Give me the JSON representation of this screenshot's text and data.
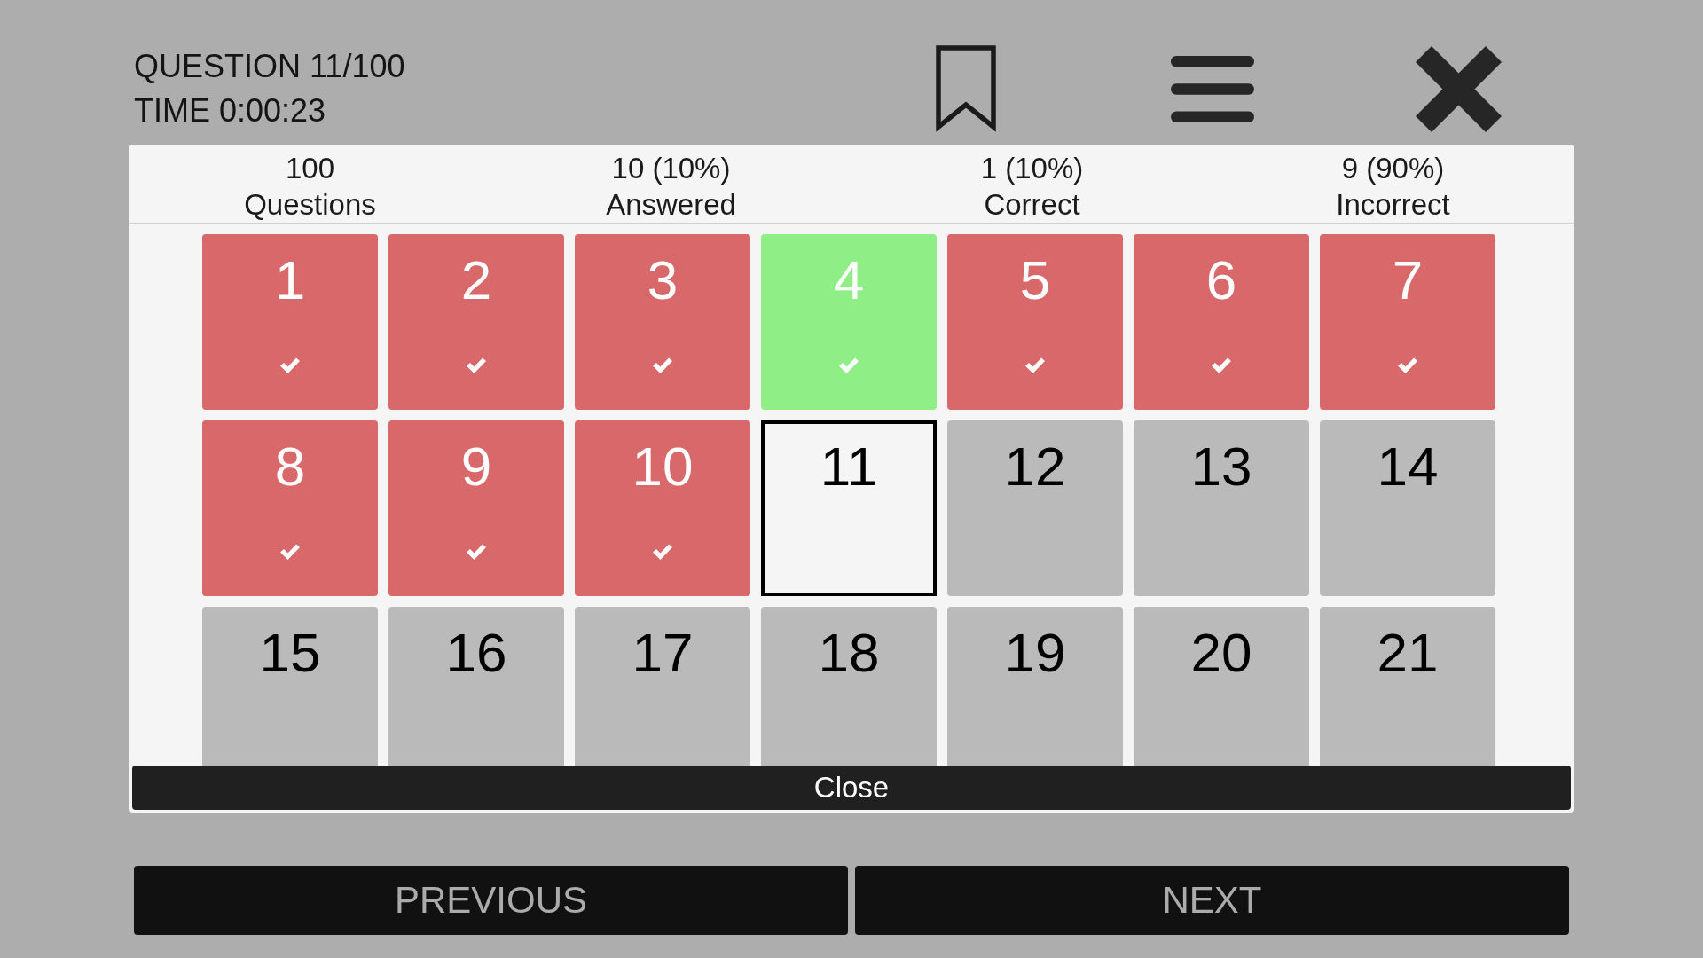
{
  "header": {
    "question": "QUESTION 11/100",
    "time": "TIME 0:00:23"
  },
  "stats": [
    {
      "value": "100",
      "label": "Questions"
    },
    {
      "value": "10 (10%)",
      "label": "Answered"
    },
    {
      "value": "1 (10%)",
      "label": "Correct"
    },
    {
      "value": "9 (90%)",
      "label": "Incorrect"
    }
  ],
  "questions": [
    {
      "number": "1",
      "answered": true,
      "correct": false,
      "selected": false
    },
    {
      "number": "2",
      "answered": true,
      "correct": false,
      "selected": false
    },
    {
      "number": "3",
      "answered": true,
      "correct": false,
      "selected": false
    },
    {
      "number": "4",
      "answered": true,
      "correct": true,
      "selected": false
    },
    {
      "number": "5",
      "answered": true,
      "correct": false,
      "selected": false
    },
    {
      "number": "6",
      "answered": true,
      "correct": false,
      "selected": false
    },
    {
      "number": "7",
      "answered": true,
      "correct": false,
      "selected": false
    },
    {
      "number": "8",
      "answered": true,
      "correct": false,
      "selected": false
    },
    {
      "number": "9",
      "answered": true,
      "correct": false,
      "selected": false
    },
    {
      "number": "10",
      "answered": true,
      "correct": false,
      "selected": false
    },
    {
      "number": "11",
      "answered": false,
      "correct": false,
      "selected": true
    },
    {
      "number": "12",
      "answered": false,
      "correct": false,
      "selected": false
    },
    {
      "number": "13",
      "answered": false,
      "correct": false,
      "selected": false
    },
    {
      "number": "14",
      "answered": false,
      "correct": false,
      "selected": false
    },
    {
      "number": "15",
      "answered": false,
      "correct": false,
      "selected": false
    },
    {
      "number": "16",
      "answered": false,
      "correct": false,
      "selected": false
    },
    {
      "number": "17",
      "answered": false,
      "correct": false,
      "selected": false
    },
    {
      "number": "18",
      "answered": false,
      "correct": false,
      "selected": false
    },
    {
      "number": "19",
      "answered": false,
      "correct": false,
      "selected": false
    },
    {
      "number": "20",
      "answered": false,
      "correct": false,
      "selected": false
    },
    {
      "number": "21",
      "answered": false,
      "correct": false,
      "selected": false
    }
  ],
  "close_button": "Close",
  "navigation": {
    "previous": "PREVIOUS",
    "next": "NEXT"
  }
}
